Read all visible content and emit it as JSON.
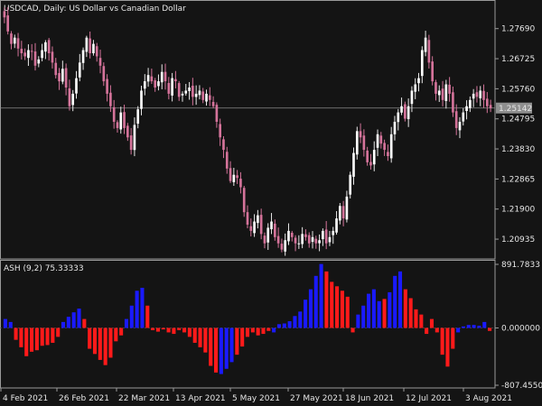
{
  "chart_data": [
    {
      "type": "candlestick",
      "title": "USDCAD, Daily:  US Dollar vs Canadian Dollar",
      "yticks": [
        "1.27690",
        "1.26725",
        "1.25760",
        "1.24795",
        "1.23830",
        "1.22865",
        "1.21900",
        "1.20935"
      ],
      "ylim": [
        1.203,
        1.2855
      ],
      "current_price": "1.25142",
      "current_price_value": 1.25142,
      "close_path": [
        1.2805,
        1.276,
        1.272,
        1.274,
        1.2705,
        1.269,
        1.268,
        1.27,
        1.2695,
        1.265,
        1.267,
        1.27,
        1.2725,
        1.269,
        1.266,
        1.262,
        1.26,
        1.264,
        1.258,
        1.252,
        1.256,
        1.261,
        1.266,
        1.27,
        1.274,
        1.269,
        1.272,
        1.268,
        1.265,
        1.26,
        1.256,
        1.252,
        1.247,
        1.245,
        1.25,
        1.245,
        1.242,
        1.238,
        1.246,
        1.251,
        1.257,
        1.26,
        1.262,
        1.26,
        1.258,
        1.26,
        1.263,
        1.26,
        1.256,
        1.261,
        1.26,
        1.255,
        1.256,
        1.257,
        1.258,
        1.255,
        1.256,
        1.257,
        1.254,
        1.256,
        1.254,
        1.252,
        1.247,
        1.242,
        1.238,
        1.232,
        1.228,
        1.23,
        1.229,
        1.226,
        1.218,
        1.214,
        1.212,
        1.215,
        1.217,
        1.211,
        1.208,
        1.213,
        1.215,
        1.21,
        1.208,
        1.206,
        1.209,
        1.212,
        1.21,
        1.208,
        1.208,
        1.211,
        1.21,
        1.208,
        1.21,
        1.208,
        1.209,
        1.212,
        1.208,
        1.21,
        1.212,
        1.216,
        1.22,
        1.216,
        1.223,
        1.23,
        1.237,
        1.244,
        1.242,
        1.238,
        1.234,
        1.233,
        1.238,
        1.243,
        1.24,
        1.238,
        1.236,
        1.243,
        1.247,
        1.25,
        1.252,
        1.248,
        1.252,
        1.257,
        1.259,
        1.261,
        1.27,
        1.274,
        1.266,
        1.26,
        1.256,
        1.257,
        1.254,
        1.259,
        1.256,
        1.25,
        1.245,
        1.247,
        1.25,
        1.252,
        1.254,
        1.256,
        1.255,
        1.257,
        1.254,
        1.252,
        1.2514
      ]
    },
    {
      "type": "bar",
      "title": "ASH (9,2) 75.33333",
      "yticks": [
        "891.7833",
        "0.000000",
        "-807.455000"
      ],
      "ylim": [
        -807.455,
        891.7833
      ],
      "colors": {
        "up": "#1a1aff",
        "down": "#ff1a1a",
        "candle": "#d4739a",
        "background": "#141414",
        "grid": "#9a9a9a",
        "text": "#e6e6e6"
      },
      "values": [
        120,
        80,
        -160,
        -260,
        -380,
        -320,
        -300,
        -240,
        -230,
        -200,
        -120,
        80,
        150,
        210,
        260,
        120,
        -280,
        -350,
        -430,
        -500,
        -400,
        -180,
        -100,
        120,
        300,
        500,
        540,
        300,
        -30,
        -50,
        -20,
        -60,
        -80,
        -30,
        -60,
        -120,
        -200,
        -260,
        -330,
        -510,
        -600,
        -620,
        -550,
        -460,
        -360,
        -250,
        -120,
        -60,
        -100,
        -80,
        -40,
        -60,
        50,
        60,
        90,
        160,
        220,
        380,
        520,
        700,
        860,
        760,
        620,
        560,
        500,
        420,
        -60,
        180,
        300,
        460,
        520,
        360,
        390,
        480,
        700,
        760,
        520,
        400,
        250,
        180,
        -80,
        120,
        -60,
        -360,
        -520,
        -280,
        -60,
        20,
        40,
        40,
        30,
        80,
        -40
      ],
      "series_colors": [
        "up",
        "up",
        "down",
        "down",
        "down",
        "down",
        "down",
        "down",
        "down",
        "down",
        "down",
        "up",
        "up",
        "up",
        "up",
        "down",
        "down",
        "down",
        "down",
        "down",
        "down",
        "down",
        "down",
        "up",
        "up",
        "up",
        "up",
        "down",
        "down",
        "down",
        "down",
        "down",
        "down",
        "down",
        "down",
        "down",
        "down",
        "down",
        "down",
        "down",
        "down",
        "up",
        "up",
        "up",
        "down",
        "down",
        "down",
        "down",
        "down",
        "down",
        "down",
        "up",
        "up",
        "up",
        "up",
        "up",
        "up",
        "up",
        "up",
        "up",
        "up",
        "down",
        "down",
        "down",
        "down",
        "down",
        "down",
        "up",
        "up",
        "up",
        "up",
        "up",
        "down",
        "up",
        "up",
        "up",
        "down",
        "down",
        "down",
        "down",
        "down",
        "down",
        "down",
        "down",
        "down",
        "down",
        "up",
        "up",
        "up",
        "up",
        "up",
        "up",
        "down"
      ]
    }
  ],
  "x_axis": {
    "labels": [
      "4 Feb 2021",
      "26 Feb 2021",
      "22 Mar 2021",
      "13 Apr 2021",
      "5 May 2021",
      "27 May 2021",
      "18 Jun 2021",
      "12 Jul 2021",
      "3 Aug 2021"
    ]
  }
}
